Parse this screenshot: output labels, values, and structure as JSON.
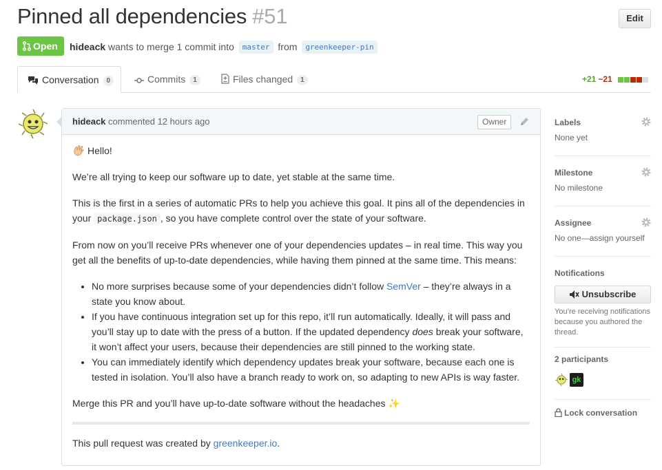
{
  "pr": {
    "title": "Pinned all dependencies",
    "number": "#51",
    "edit_label": "Edit",
    "state": "Open",
    "author": "hideack",
    "merge_text_1": "wants to merge 1 commit into",
    "base_branch": "master",
    "merge_text_2": "from",
    "head_branch": "greenkeeper-pin"
  },
  "tabs": [
    {
      "label": "Conversation",
      "count": "0"
    },
    {
      "label": "Commits",
      "count": "1"
    },
    {
      "label": "Files changed",
      "count": "1"
    }
  ],
  "diffstat": {
    "additions": "+21",
    "deletions": "−21",
    "add_color": "#55a532",
    "del_color": "#bd2c00",
    "gray_color": "#ddd"
  },
  "comment": {
    "author": "hideack",
    "meta": "commented 12 hours ago",
    "owner_badge": "Owner",
    "greeting": "Hello!",
    "p1": "We’re all trying to keep our software up to date, yet stable at the same time.",
    "p2_before": "This is the first in a series of automatic PRs to help you achieve this goal. It pins all of the dependencies in your",
    "p2_code": "package.json",
    "p2_after": ", so you have complete control over the state of your software.",
    "p3": "From now on you’ll receive PRs whenever one of your dependencies updates – in real time. This way you get all the benefits of up-to-date dependencies, while having them pinned at the same time. This means:",
    "li1_before": "No more surprises because some of your dependencies didn’t follow",
    "li1_link": "SemVer",
    "li1_after": "– they’re always in a state you know about.",
    "li2_before": "If you have continuous integration set up for this repo, it’ll run automatically. Ideally, it will pass and you’ll stay up to date with the press of a button. If the updated dependency",
    "li2_em": "does",
    "li2_after": "break your software, it won’t affect your users, because their dependencies are still pinned to the working state.",
    "li3": "You can immediately identify which dependency updates break your software, because each one is tested in isolation. You’ll also have a branch ready to work on, so adapting to new APIs is way faster.",
    "p4": "Merge this PR and you’ll have up-to-date software without the headaches",
    "sparkles": "✨",
    "footer_before": "This pull request was created by",
    "footer_link": "greenkeeper.io",
    "footer_after": "."
  },
  "sidebar": {
    "labels_title": "Labels",
    "labels_value": "None yet",
    "milestone_title": "Milestone",
    "milestone_value": "No milestone",
    "assignee_title": "Assignee",
    "assignee_value": "No one—assign yourself",
    "notifications_title": "Notifications",
    "unsubscribe_label": "Unsubscribe",
    "notifications_note": "You’re receiving notifications because you authored the thread.",
    "participants_title": "2 participants",
    "gk_avatar_text": "gk",
    "lock_label": "Lock conversation"
  }
}
